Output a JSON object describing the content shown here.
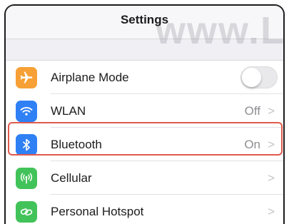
{
  "header": {
    "title": "Settings",
    "watermark": "www.LU"
  },
  "colors": {
    "airplane": "#f7a035",
    "wlan": "#2f80f5",
    "bluetooth": "#2f80f5",
    "cellular": "#42c35a",
    "hotspot": "#42c35a",
    "highlight": "#e05a4c"
  },
  "settings": {
    "items": [
      {
        "label": "Airplane Mode",
        "icon": "airplane-icon",
        "toggle_on": false
      },
      {
        "label": "WLAN",
        "icon": "wifi-icon",
        "value": "Off",
        "chevron": ">"
      },
      {
        "label": "Bluetooth",
        "icon": "bluetooth-icon",
        "value": "On",
        "chevron": ">",
        "highlighted": true
      },
      {
        "label": "Cellular",
        "icon": "antenna-icon",
        "chevron": ">"
      },
      {
        "label": "Personal Hotspot",
        "icon": "link-icon",
        "chevron": ">"
      }
    ]
  }
}
